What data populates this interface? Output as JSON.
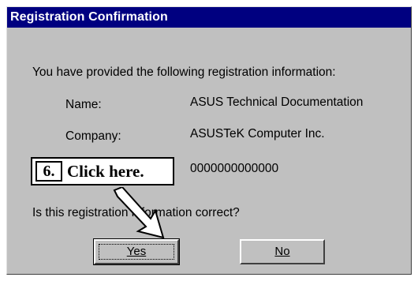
{
  "dialog": {
    "title": "Registration Confirmation",
    "intro": "You have provided the following registration information:",
    "name_label": "Name:",
    "name_value": "ASUS Technical Documentation",
    "company_label": "Company:",
    "company_value": "ASUSTeK Computer Inc.",
    "serial_value": "0000000000000",
    "question": "Is this registration information correct?",
    "yes_label": "Yes",
    "no_label": "No",
    "titlebar_color": "#000080",
    "background_color": "#c0c0c0"
  },
  "callout": {
    "step_number": "6.",
    "text": "Click here.",
    "icon": "pointer-arrow-icon"
  }
}
